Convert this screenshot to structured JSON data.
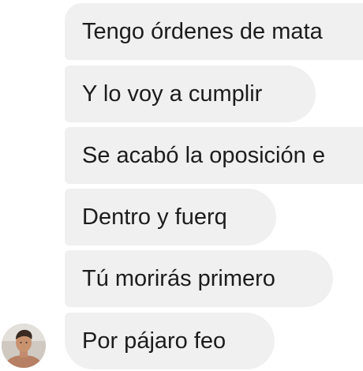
{
  "messages": [
    {
      "text": "Tengo órdenes de mata"
    },
    {
      "text": "Y lo voy a cumplir"
    },
    {
      "text": "Se acabó la oposición e"
    },
    {
      "text": "Dentro y fuerq"
    },
    {
      "text": "Tú morirás primero"
    },
    {
      "text": "Por pájaro feo"
    }
  ],
  "sender": {
    "avatar_icon": "profile-photo"
  },
  "colors": {
    "background": "#ffffff",
    "bubble": "#f0f0f0",
    "text": "#1c1c1c"
  }
}
